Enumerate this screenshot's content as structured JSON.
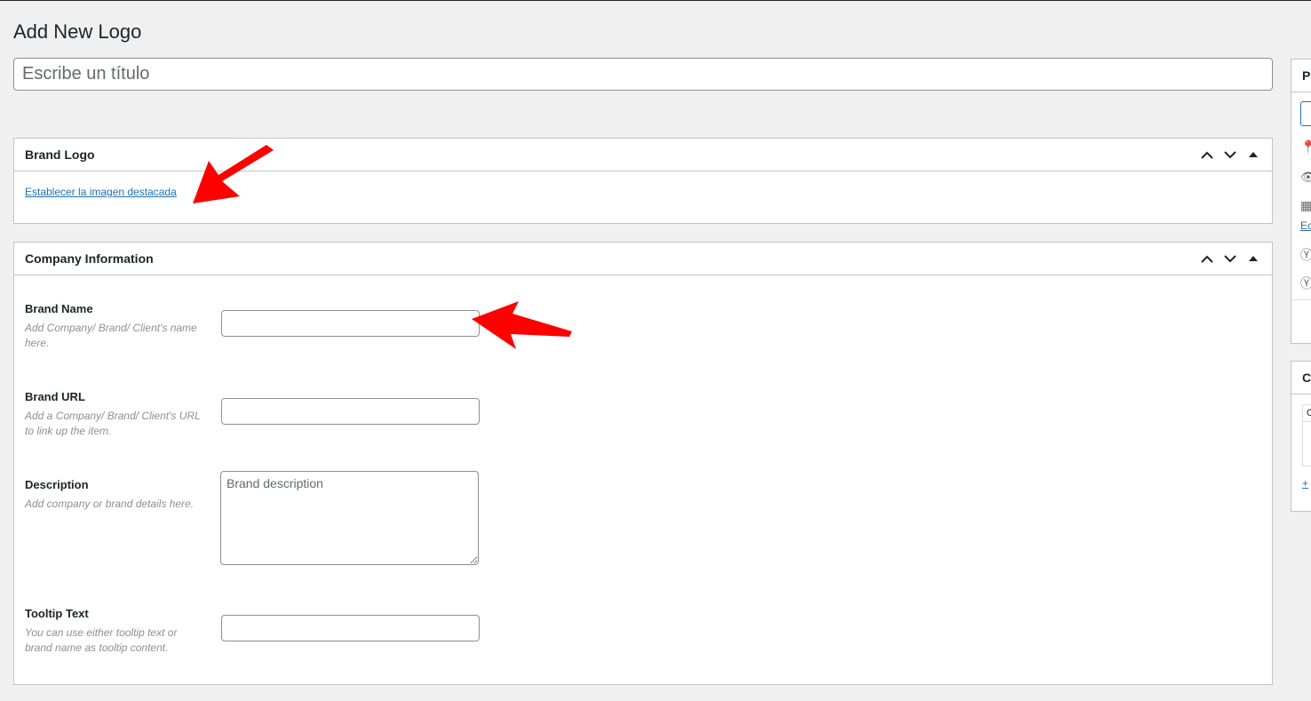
{
  "page": {
    "title": "Add New Logo",
    "title_placeholder": "Escribe un título"
  },
  "brand_logo_box": {
    "title": "Brand Logo",
    "set_featured_link": "Establecer la imagen destacada"
  },
  "company_box": {
    "title": "Company Information",
    "fields": [
      {
        "label": "Brand Name",
        "description": "Add Company/ Brand/ Client's name here.",
        "value": ""
      },
      {
        "label": "Brand URL",
        "description": "Add a Company/ Brand/ Client's URL to link up the item.",
        "value": ""
      },
      {
        "label": "Description",
        "description": "Add company or brand details here.",
        "placeholder": "Brand description",
        "value": ""
      },
      {
        "label": "Tooltip Text",
        "description": "You can use either tooltip text or brand name as tooltip content.",
        "value": ""
      }
    ]
  },
  "sidebar": {
    "publish_box_title_fragment": "P",
    "categories_box_title_fragment": "C",
    "edit_link_fragment": "Ec",
    "add_category_fragment": "+",
    "category_tab_fragment": "C"
  },
  "annotations": {
    "arrow_color": "#ff0000"
  },
  "colors": {
    "background": "#f0f0f1",
    "panel": "#ffffff",
    "border": "#c3c4c7",
    "link": "#2271b1",
    "muted_text": "#8c8f94"
  },
  "icons": {
    "move_up": "chevron-up-icon",
    "move_down": "chevron-down-icon",
    "toggle": "triangle-up-icon"
  }
}
